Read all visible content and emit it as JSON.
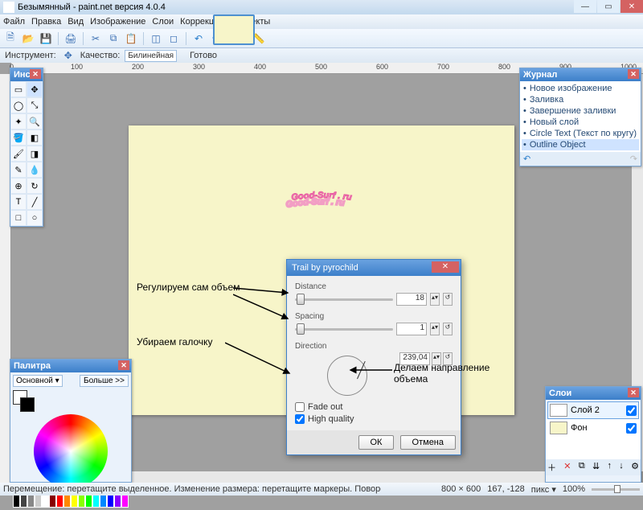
{
  "app": {
    "title": "Безымянный - paint.net версия 4.0.4"
  },
  "menu": [
    "Файл",
    "Правка",
    "Вид",
    "Изображение",
    "Слои",
    "Коррекция",
    "Эффекты"
  ],
  "options": {
    "instrument": "Инструмент:",
    "quality_label": "Качество:",
    "quality_value": "Билинейная",
    "status": "Готово"
  },
  "tools_panel_title": "Инст...",
  "history_panel": {
    "title": "Журнал",
    "items": [
      {
        "label": "Новое изображение",
        "sel": false
      },
      {
        "label": "Заливка",
        "sel": false
      },
      {
        "label": "Завершение заливки",
        "sel": false
      },
      {
        "label": "Новый слой",
        "sel": false
      },
      {
        "label": "Circle Text (Текст по кругу)",
        "sel": false
      },
      {
        "label": "Outline Object",
        "sel": true
      }
    ]
  },
  "colors_panel": {
    "title": "Палитра",
    "dd": "Основной ▾",
    "more": "Больше >>"
  },
  "layers_panel": {
    "title": "Слои",
    "items": [
      {
        "label": "Слой 2",
        "sel": true,
        "bg": "#fff"
      },
      {
        "label": "Фон",
        "sel": false,
        "bg": "#f7f5c9"
      }
    ]
  },
  "dialog": {
    "title": "Trail by pyrochild",
    "distance_label": "Distance",
    "distance_val": "18",
    "spacing_label": "Spacing",
    "spacing_val": "1",
    "direction_label": "Direction",
    "direction_val": "239,04",
    "fade_label": "Fade out",
    "hq_label": "High quality",
    "ok": "ОК",
    "cancel": "Отмена"
  },
  "annotations": {
    "a1": "Регулируем сам объем",
    "a2": "Убираем галочку",
    "a3": "Делаем направление объема"
  },
  "canvas_text": "Good-Surf . ru",
  "status": {
    "hint": "Перемещение: перетащите выделенное. Изменение размера: перетащите маркеры. Поворот: перетащите правой кнопкой.",
    "dims": "800 × 600",
    "pos": "167, -128",
    "unit": "пикс ▾",
    "zoom": "100%"
  },
  "ruler_ticks": [
    "0",
    "100",
    "200",
    "300",
    "400",
    "500",
    "600",
    "700",
    "800",
    "900",
    "1000"
  ],
  "palette": [
    "#000",
    "#444",
    "#888",
    "#ccc",
    "#fff",
    "#800",
    "#f00",
    "#f80",
    "#ff0",
    "#8f0",
    "#0f0",
    "#0ff",
    "#08f",
    "#00f",
    "#80f",
    "#f0f"
  ]
}
